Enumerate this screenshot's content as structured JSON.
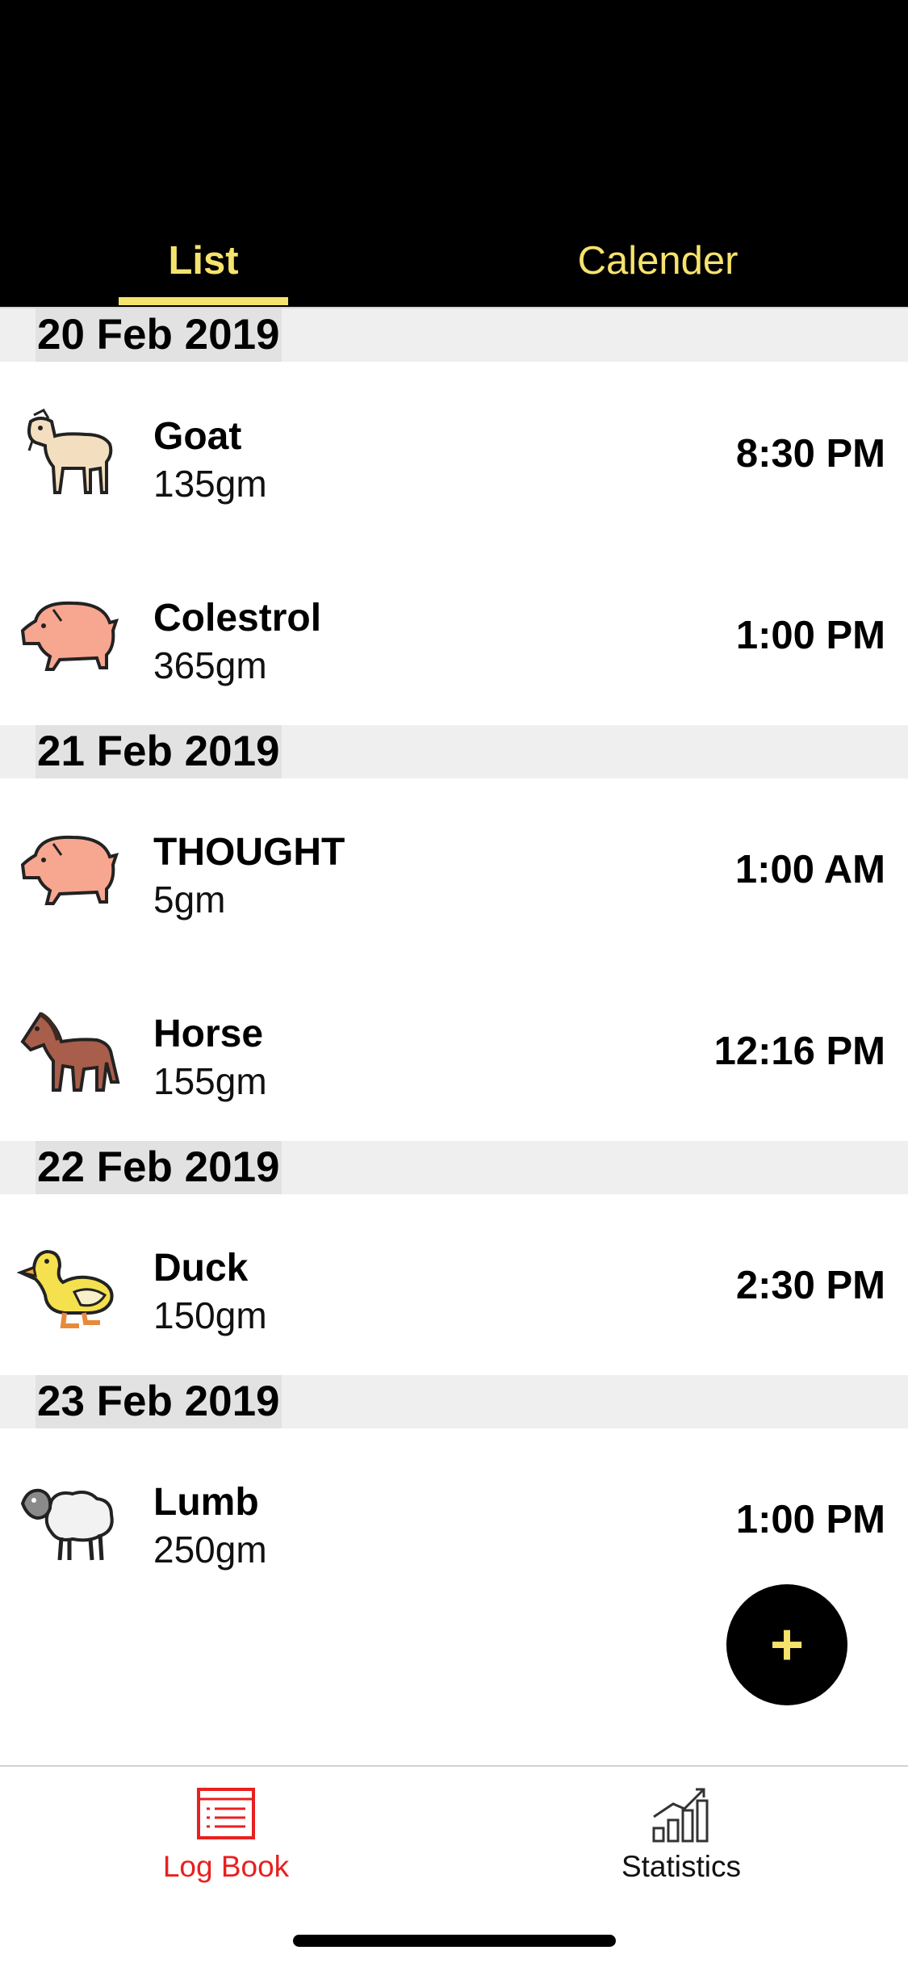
{
  "tabs": {
    "list": "List",
    "calender": "Calender"
  },
  "sections": [
    {
      "date": "20 Feb 2019",
      "entries": [
        {
          "animal_icon": "goat-icon",
          "name": "Goat",
          "weight": "135gm",
          "time": "8:30 PM"
        },
        {
          "animal_icon": "pig-icon",
          "name": "Colestrol",
          "weight": "365gm",
          "time": "1:00 PM"
        }
      ]
    },
    {
      "date": "21 Feb 2019",
      "entries": [
        {
          "animal_icon": "pig-icon",
          "name": "THOUGHT",
          "weight": "5gm",
          "time": "1:00 AM"
        },
        {
          "animal_icon": "horse-icon",
          "name": "Horse",
          "weight": "155gm",
          "time": "12:16 PM"
        }
      ]
    },
    {
      "date": "22 Feb 2019",
      "entries": [
        {
          "animal_icon": "duck-icon",
          "name": "Duck",
          "weight": "150gm",
          "time": "2:30 PM"
        }
      ]
    },
    {
      "date": "23 Feb 2019",
      "entries": [
        {
          "animal_icon": "sheep-icon",
          "name": "Lumb",
          "weight": "250gm",
          "time": "1:00 PM"
        }
      ]
    }
  ],
  "fab": {
    "label": "+"
  },
  "bottom_nav": [
    {
      "label": "Log Book",
      "icon": "logbook-icon",
      "active": true
    },
    {
      "label": "Statistics",
      "icon": "statistics-icon",
      "active": false
    }
  ],
  "colors": {
    "accent_yellow": "#f6e36c",
    "active_red": "#e8201f",
    "header_bg": "#000000"
  }
}
